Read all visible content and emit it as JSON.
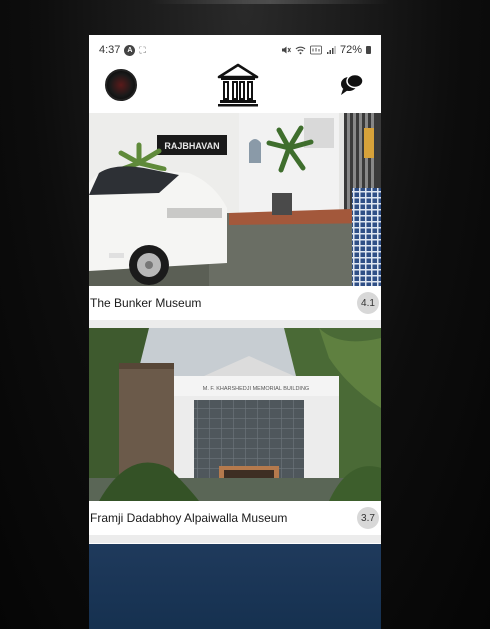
{
  "status": {
    "time": "4:37",
    "battery": "72%"
  },
  "header": {
    "avatar": "avatar",
    "logo": "museum-icon",
    "chat": "chat-icon"
  },
  "museums": [
    {
      "name": "The Bunker Museum",
      "rating": "4.1",
      "sign": "RAJBHAVAN"
    },
    {
      "name": "Framji Dadabhoy Alpaiwalla Museum",
      "rating": "3.7",
      "sign": "M. F. KHARSHEDJI MEMORIAL BUILDING"
    }
  ],
  "colors": {
    "accent": "#1a1a1a",
    "rating_bg": "#d8d8d8",
    "card3_bg": "#1f3a5c"
  }
}
